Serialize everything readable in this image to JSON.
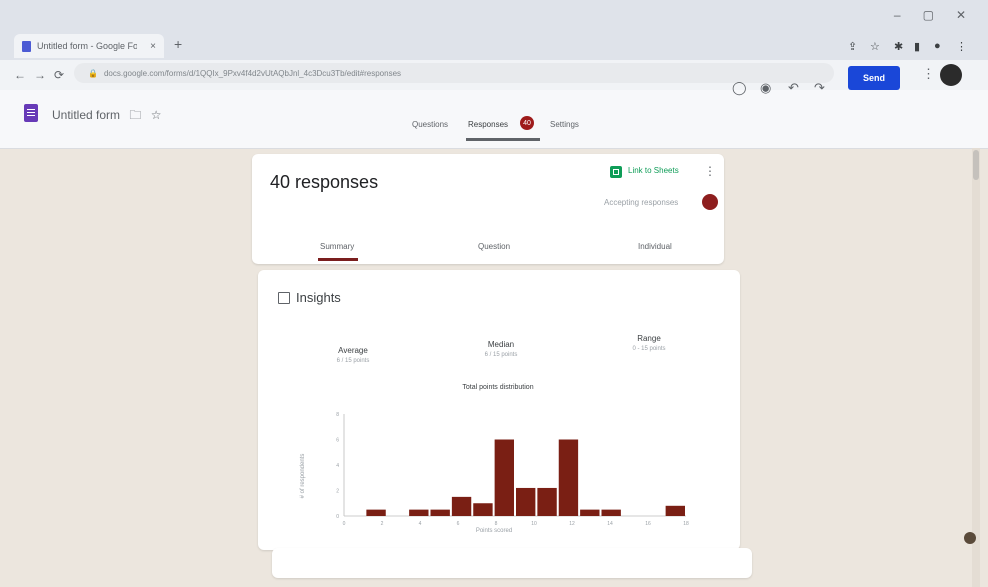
{
  "browser": {
    "tab_title": "Untitled form - Google Forms",
    "url": "docs.google.com/forms/d/1QQIx_9Pxv4f4d2vUtAQbJnl_4c3Dcu3Tb/edit#responses"
  },
  "header": {
    "form_title": "Untitled form",
    "send_label": "Send",
    "tabs": [
      {
        "label": "Questions"
      },
      {
        "label": "Responses",
        "badge": "40"
      },
      {
        "label": "Settings"
      }
    ]
  },
  "responses": {
    "title": "40 responses",
    "sheets_link": "Link to Sheets",
    "accepting": "Accepting responses",
    "subtabs": [
      "Summary",
      "Question",
      "Individual"
    ]
  },
  "insights": {
    "title": "Insights",
    "stats": [
      {
        "label": "Average",
        "value": "6 / 15 points"
      },
      {
        "label": "Median",
        "value": "6 / 15 points"
      },
      {
        "label": "Range",
        "value": "0 - 15 points"
      }
    ]
  },
  "chart_data": {
    "type": "bar",
    "title": "Total points distribution",
    "xlabel": "Points scored",
    "ylabel": "# of respondents",
    "x": [
      0,
      1,
      2,
      3,
      4,
      5,
      6,
      7,
      8,
      9,
      10,
      11,
      12,
      13,
      14,
      15
    ],
    "values": [
      0,
      0.5,
      0,
      0.5,
      0.5,
      1.5,
      1,
      6,
      2.2,
      2.2,
      6,
      0.5,
      0.5,
      0,
      0,
      0.8
    ],
    "xticks": [
      0,
      2,
      4,
      6,
      8,
      10,
      12,
      14,
      16,
      18
    ],
    "yticks": [
      0,
      2,
      4,
      6,
      8
    ],
    "ylim": [
      0,
      8
    ],
    "bar_color": "#7a1f14"
  },
  "colors": {
    "accent": "#7a1e1e",
    "send": "#1a47d8"
  }
}
